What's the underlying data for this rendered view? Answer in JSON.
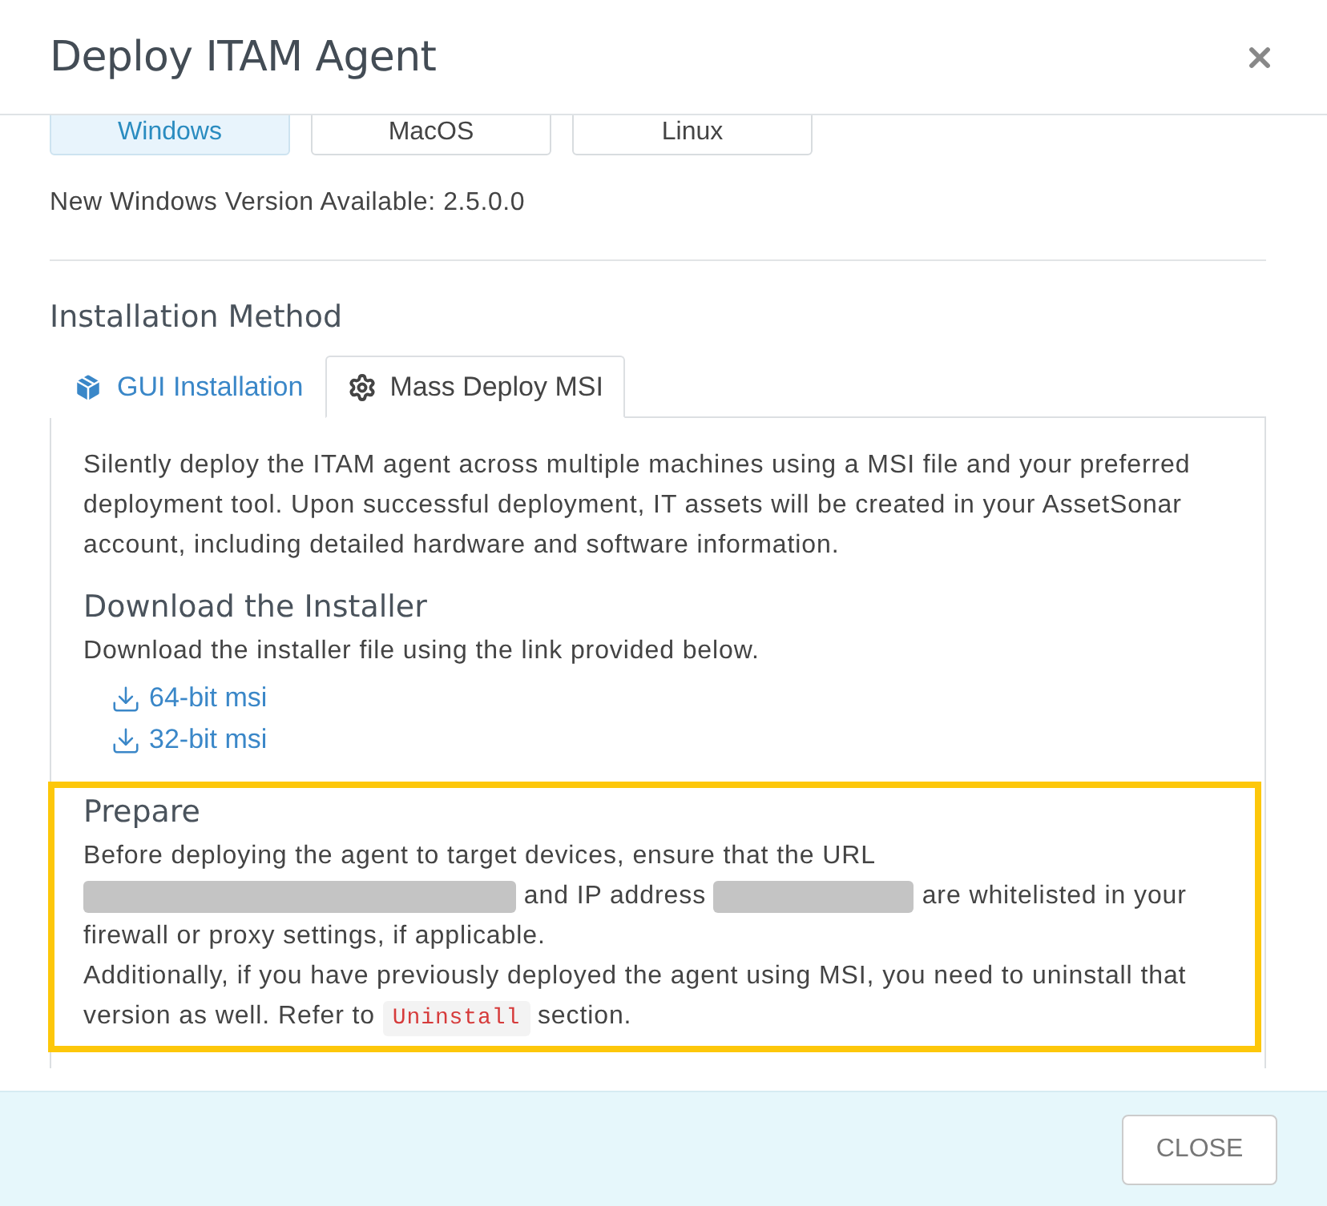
{
  "window": {
    "title": "Deploy ITAM Agent"
  },
  "os_tabs": [
    {
      "label": "Windows",
      "selected": true
    },
    {
      "label": "MacOS",
      "selected": false
    },
    {
      "label": "Linux",
      "selected": false
    }
  ],
  "version_notice": "New Windows Version Available: 2.5.0.0",
  "section_title": "Installation Method",
  "method_tabs": [
    {
      "label": "GUI Installation",
      "selected": false
    },
    {
      "label": "Mass Deploy MSI",
      "selected": true
    }
  ],
  "panel": {
    "intro": "Silently deploy the ITAM agent across multiple machines using a MSI file and your preferred deployment tool. Upon successful deployment, IT assets will be created in your AssetSonar account, including detailed hardware and software information.",
    "download": {
      "title": "Download the Installer",
      "text": "Download the installer file using the link provided below.",
      "links": [
        "64-bit msi",
        "32-bit msi"
      ]
    },
    "prepare": {
      "title": "Prepare",
      "highlighted": true,
      "paragraphs": [
        [
          {
            "kind": "text",
            "text": "Before deploying the agent to target devices, ensure that the URL "
          },
          {
            "kind": "redacted"
          },
          {
            "kind": "text",
            "text": " and IP address "
          },
          {
            "kind": "redacted"
          },
          {
            "kind": "text",
            "text": " are whitelisted in your firewall or proxy settings, if applicable."
          }
        ],
        [
          {
            "kind": "text",
            "text": "Additionally, if you have previously deployed the agent using MSI, you need to uninstall that version as well. Refer to "
          },
          {
            "kind": "code",
            "text": "Uninstall"
          },
          {
            "kind": "text",
            "text": " section."
          }
        ]
      ]
    }
  },
  "footer": {
    "buttons": [
      "CLOSE"
    ]
  }
}
